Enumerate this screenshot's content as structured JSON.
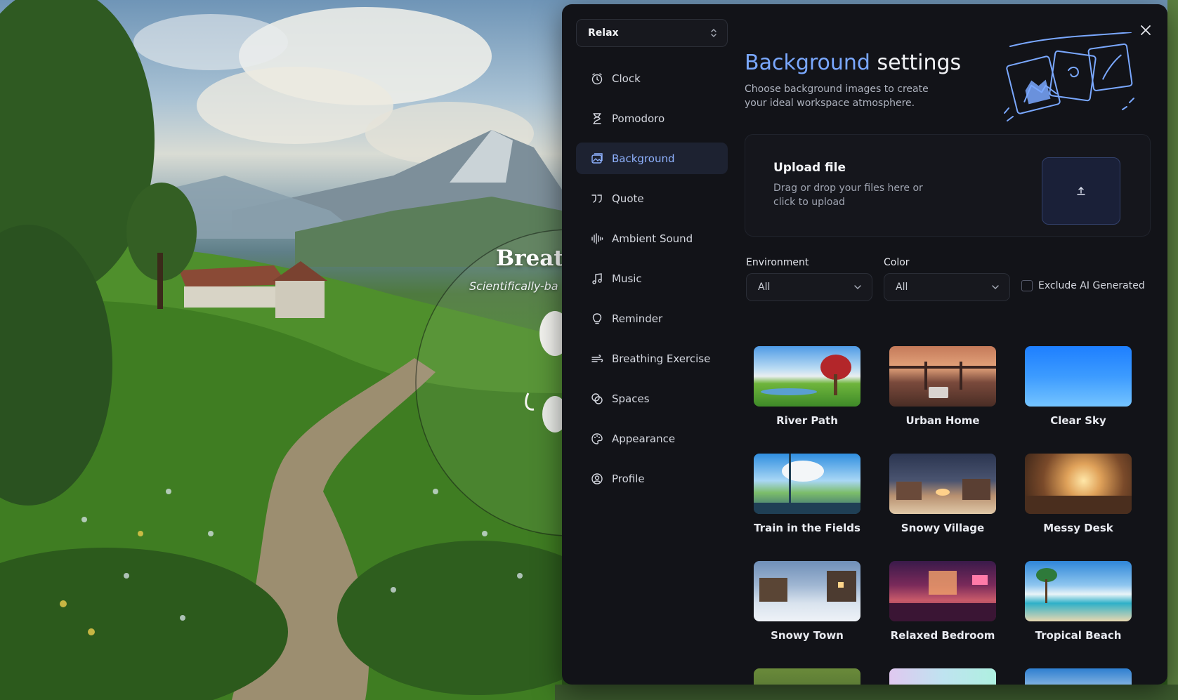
{
  "scene": {
    "breathing_title": "Breath",
    "breathing_subtitle": "Scientifically-ba"
  },
  "preset": {
    "value": "Relax"
  },
  "nav": {
    "items": [
      {
        "label": "Clock",
        "icon": "clock-icon"
      },
      {
        "label": "Pomodoro",
        "icon": "hourglass-icon"
      },
      {
        "label": "Background",
        "icon": "image-stack-icon",
        "active": true
      },
      {
        "label": "Quote",
        "icon": "quote-icon"
      },
      {
        "label": "Ambient Sound",
        "icon": "sound-wave-icon"
      },
      {
        "label": "Music",
        "icon": "music-note-icon"
      },
      {
        "label": "Reminder",
        "icon": "lightbulb-icon"
      },
      {
        "label": "Breathing Exercise",
        "icon": "wind-icon"
      },
      {
        "label": "Spaces",
        "icon": "spaces-icon"
      },
      {
        "label": "Appearance",
        "icon": "palette-icon"
      },
      {
        "label": "Profile",
        "icon": "user-circle-icon"
      }
    ]
  },
  "content": {
    "heading_accent": "Background",
    "heading_rest": " settings",
    "description": "Choose background images to create your ideal workspace atmosphere.",
    "upload": {
      "title": "Upload file",
      "description": "Drag or drop your files here or click to upload"
    },
    "filters": {
      "environment_label": "Environment",
      "environment_value": "All",
      "color_label": "Color",
      "color_value": "All",
      "exclude_ai_label": "Exclude AI Generated",
      "exclude_ai_checked": false
    },
    "backgrounds": [
      {
        "name": "River Path"
      },
      {
        "name": "Urban Home"
      },
      {
        "name": "Clear Sky"
      },
      {
        "name": "Train in the Fields"
      },
      {
        "name": "Snowy Village"
      },
      {
        "name": "Messy Desk"
      },
      {
        "name": "Snowy Town"
      },
      {
        "name": "Relaxed Bedroom"
      },
      {
        "name": "Tropical Beach"
      }
    ]
  },
  "colors": {
    "accent": "#7aa8ff",
    "modal_bg": "#121318",
    "active_nav_bg": "#1d2231"
  }
}
